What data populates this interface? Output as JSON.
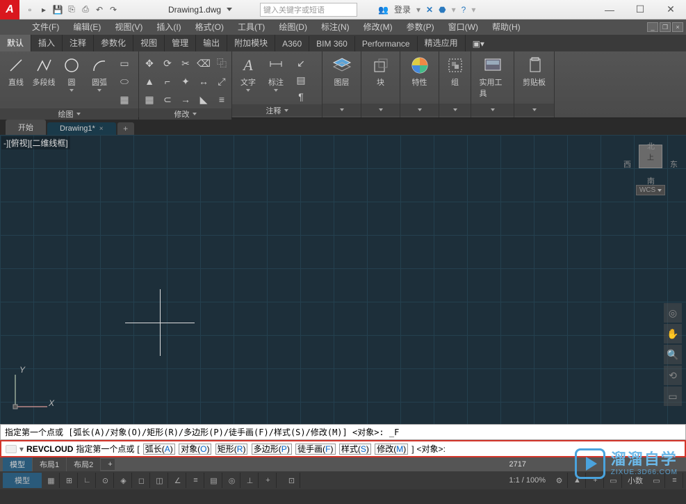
{
  "title": {
    "doc": "Drawing1.dwg",
    "search_placeholder": "键入关键字或短语",
    "login": "登录"
  },
  "menu": [
    "文件(F)",
    "编辑(E)",
    "视图(V)",
    "插入(I)",
    "格式(O)",
    "工具(T)",
    "绘图(D)",
    "标注(N)",
    "修改(M)",
    "参数(P)",
    "窗口(W)",
    "帮助(H)"
  ],
  "ribbon_tabs": [
    "默认",
    "插入",
    "注释",
    "参数化",
    "视图",
    "管理",
    "输出",
    "附加模块",
    "A360",
    "BIM 360",
    "Performance",
    "精选应用"
  ],
  "ribbon_active": 0,
  "panels": {
    "draw": {
      "title": "绘图",
      "btns": [
        "直线",
        "多段线",
        "圆",
        "圆弧"
      ]
    },
    "modify": {
      "title": "修改"
    },
    "annot": {
      "title": "注释",
      "btns": [
        "文字",
        "标注"
      ]
    },
    "layer": {
      "title": "图层"
    },
    "block": {
      "title": "块"
    },
    "prop": {
      "title": "特性"
    },
    "group": {
      "title": "组"
    },
    "util": {
      "title": "实用工具"
    },
    "clip": {
      "title": "剪贴板"
    }
  },
  "file_tabs": {
    "start": "开始",
    "active": "Drawing1*"
  },
  "view_label": "-][俯视][二维线框]",
  "viewcube": {
    "n": "北",
    "s": "南",
    "e": "东",
    "w": "西",
    "top": "上",
    "wcs": "WCS"
  },
  "ucs": {
    "x": "X",
    "y": "Y"
  },
  "cmd1": "指定第一个点或 [弧长(A)/对象(O)/矩形(R)/多边形(P)/徒手画(F)/样式(S)/修改(M)] <对象>: _F",
  "cmd2": {
    "name": "REVCLOUD",
    "prompt": "指定第一个点或",
    "opts_open": "[",
    "opts": [
      {
        "t": "弧长",
        "k": "A"
      },
      {
        "t": "对象",
        "k": "O"
      },
      {
        "t": "矩形",
        "k": "R"
      },
      {
        "t": "多边形",
        "k": "P"
      },
      {
        "t": "徒手画",
        "k": "F"
      },
      {
        "t": "样式",
        "k": "S"
      },
      {
        "t": "修改",
        "k": "M"
      }
    ],
    "opts_close": "]",
    "default": "<对象>:"
  },
  "layout_tabs": [
    "模型",
    "布局1",
    "布局2"
  ],
  "status": {
    "coord": "2717",
    "scale": "1:1 / 100%",
    "deci": "小数"
  },
  "watermark": {
    "main": "溜溜自学",
    "sub": "ZIXUE.3D66.COM"
  }
}
